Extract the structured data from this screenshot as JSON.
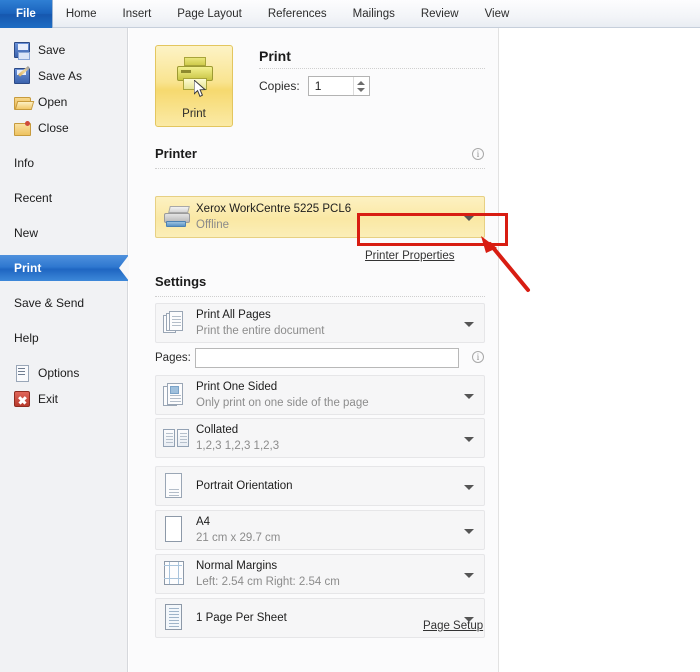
{
  "ribbon": {
    "tabs": [
      {
        "label": "File",
        "active": true
      },
      {
        "label": "Home",
        "active": false
      },
      {
        "label": "Insert",
        "active": false
      },
      {
        "label": "Page Layout",
        "active": false
      },
      {
        "label": "References",
        "active": false
      },
      {
        "label": "Mailings",
        "active": false
      },
      {
        "label": "Review",
        "active": false
      },
      {
        "label": "View",
        "active": false
      }
    ]
  },
  "sidebar": {
    "items": [
      {
        "label": "Save",
        "icon": "floppy-disk-icon"
      },
      {
        "label": "Save As",
        "icon": "floppy-disk-pencil-icon"
      },
      {
        "label": "Open",
        "icon": "open-folder-icon"
      },
      {
        "label": "Close",
        "icon": "folder-close-icon"
      },
      {
        "label": "Info",
        "icon": ""
      },
      {
        "label": "Recent",
        "icon": ""
      },
      {
        "label": "New",
        "icon": ""
      },
      {
        "label": "Print",
        "icon": "",
        "selected": true
      },
      {
        "label": "Save & Send",
        "icon": ""
      },
      {
        "label": "Help",
        "icon": ""
      },
      {
        "label": "Options",
        "icon": "document-options-icon"
      },
      {
        "label": "Exit",
        "icon": "red-x-icon"
      }
    ]
  },
  "print": {
    "button_label": "Print",
    "heading": "Print",
    "copies_label": "Copies:",
    "copies_value": "1"
  },
  "printer": {
    "heading": "Printer",
    "name": "Xerox WorkCentre 5225 PCL6",
    "status": "Offline",
    "properties_link": "Printer Properties"
  },
  "settings": {
    "heading": "Settings",
    "rows": [
      {
        "title": "Print All Pages",
        "subtitle": "Print the entire document",
        "icon": "stacked-pages-icon"
      },
      {
        "title": "Print One Sided",
        "subtitle": "Only print on one side of the page",
        "icon": "one-sided-icon"
      },
      {
        "title": "Collated",
        "subtitle": "1,2,3   1,2,3   1,2,3",
        "icon": "collated-icon"
      },
      {
        "title": "Portrait Orientation",
        "subtitle": "",
        "icon": "portrait-icon"
      },
      {
        "title": "A4",
        "subtitle": "21 cm x 29.7 cm",
        "icon": "paper-icon"
      },
      {
        "title": "Normal Margins",
        "subtitle": "Left: 2.54 cm   Right: 2.54 cm",
        "icon": "margins-icon"
      },
      {
        "title": "1 Page Per Sheet",
        "subtitle": "",
        "icon": "pages-per-sheet-icon"
      }
    ],
    "pages_label": "Pages:",
    "pages_value": "",
    "pages_placeholder": "",
    "page_setup_link": "Page Setup"
  },
  "colors": {
    "file_tab": "#1a63bd",
    "selected_nav": "#2f78d0",
    "print_button": "#f9e490",
    "printer_box": "#fae8a4",
    "annotation": "#d81d12"
  }
}
